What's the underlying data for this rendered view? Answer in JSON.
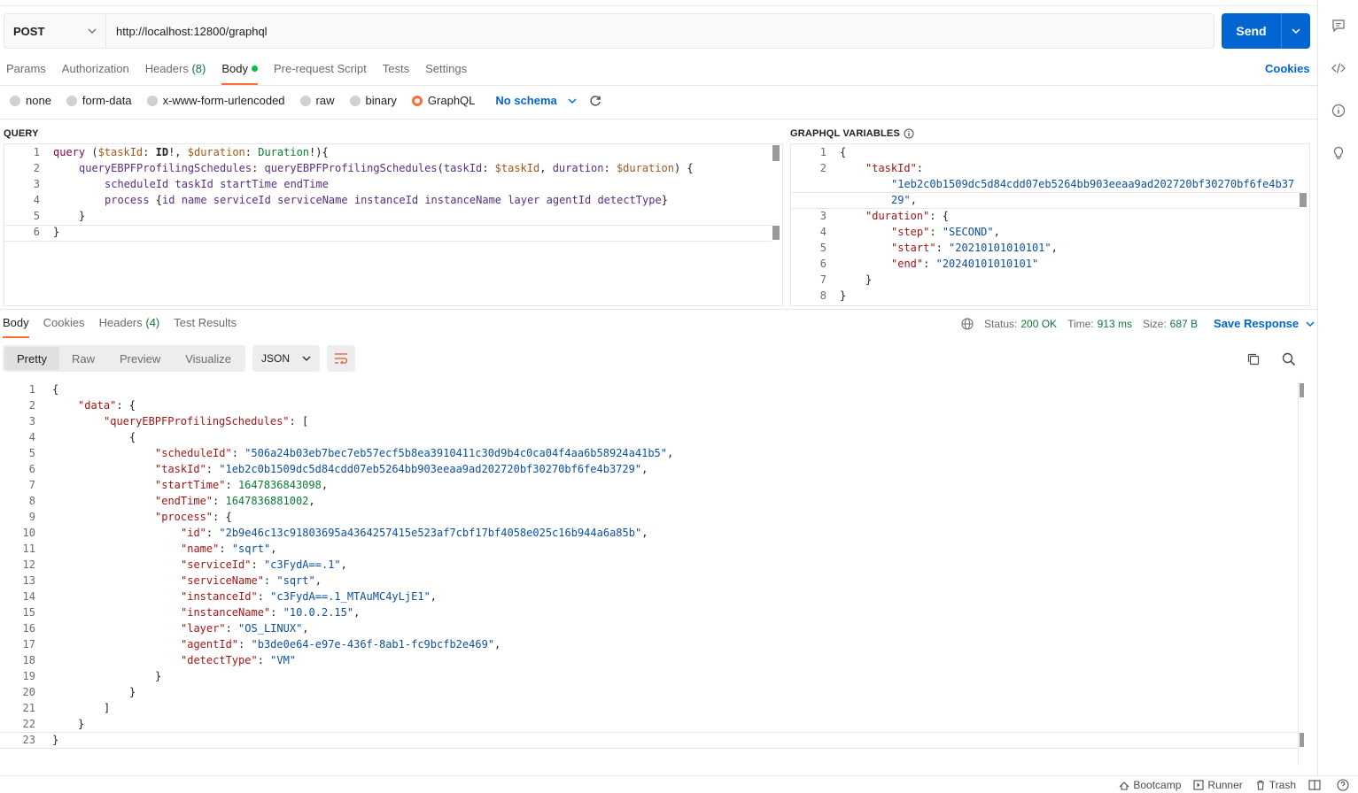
{
  "request": {
    "method": "POST",
    "url": "http://localhost:12800/graphql",
    "send_label": "Send",
    "cookies_label": "Cookies",
    "tabs": [
      {
        "label": "Params"
      },
      {
        "label": "Authorization"
      },
      {
        "label": "Headers",
        "count": "(8)"
      },
      {
        "label": "Body"
      },
      {
        "label": "Pre-request Script"
      },
      {
        "label": "Tests"
      },
      {
        "label": "Settings"
      }
    ],
    "body_modes": [
      "none",
      "form-data",
      "x-www-form-urlencoded",
      "raw",
      "binary",
      "GraphQL"
    ],
    "schema_label": "No schema"
  },
  "query": {
    "label": "QUERY",
    "line_numbers": [
      "1",
      "2",
      "3",
      "4",
      "5",
      "6"
    ]
  },
  "variables": {
    "label": "GRAPHQL VARIABLES",
    "line_numbers": [
      "1",
      "2",
      "",
      "3",
      "4",
      "5",
      "6",
      "7",
      "8"
    ],
    "task_id_part1": "1eb2c0b1509dc5d84cdd07eb5264bb903eeaa9ad202720bf30270bf6fe4b37",
    "task_id_part2": "29",
    "step": "SECOND",
    "start": "20210101010101",
    "end": "20240101010101"
  },
  "response": {
    "tabs": [
      {
        "label": "Body"
      },
      {
        "label": "Cookies"
      },
      {
        "label": "Headers",
        "count": "(4)"
      },
      {
        "label": "Test Results"
      }
    ],
    "status_label": "Status:",
    "status_value": "200 OK",
    "time_label": "Time:",
    "time_value": "913 ms",
    "size_label": "Size:",
    "size_value": "687 B",
    "save_label": "Save Response",
    "views": [
      "Pretty",
      "Raw",
      "Preview",
      "Visualize"
    ],
    "format": "JSON",
    "line_numbers": [
      "1",
      "2",
      "3",
      "4",
      "5",
      "6",
      "7",
      "8",
      "9",
      "10",
      "11",
      "12",
      "13",
      "14",
      "15",
      "16",
      "17",
      "18",
      "19",
      "20",
      "21",
      "22",
      "23"
    ],
    "json": {
      "scheduleId": "506a24b03eb7bec7eb57ecf5b8ea3910411c30d9b4c0ca04f4aa6b58924a41b5",
      "taskId": "1eb2c0b1509dc5d84cdd07eb5264bb903eeaa9ad202720bf30270bf6fe4b3729",
      "startTime": "1647836843098",
      "endTime": "1647836881002",
      "id": "2b9e46c13c91803695a4364257415e523af7cbf17bf4058e025c16b944a6a85b",
      "name": "sqrt",
      "serviceId": "c3FydA==.1",
      "serviceName": "sqrt",
      "instanceId": "c3FydA==.1_MTAuMC4yLjE1",
      "instanceName": "10.0.2.15",
      "layer": "OS_LINUX",
      "agentId": "b3de0e64-e97e-436f-8ab1-fc9bcfb2e469",
      "detectType": "VM"
    }
  },
  "footer": {
    "bootcamp": "Bootcamp",
    "runner": "Runner",
    "trash": "Trash"
  }
}
